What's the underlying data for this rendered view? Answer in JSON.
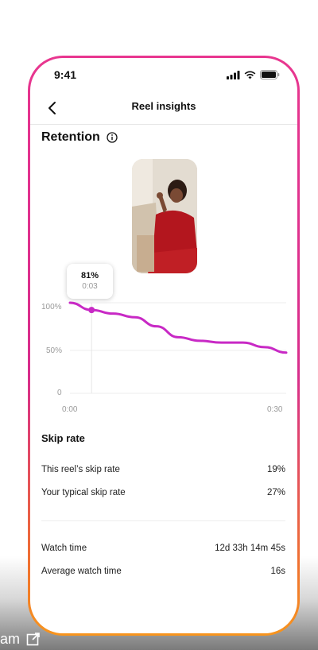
{
  "status_bar": {
    "time": "9:41"
  },
  "header": {
    "title": "Reel insights"
  },
  "retention": {
    "title": "Retention",
    "tooltip": {
      "value": "81%",
      "time": "0:03"
    },
    "chart_data": {
      "type": "line",
      "x": [
        0,
        3,
        6,
        9,
        12,
        15,
        18,
        21,
        24,
        27,
        30
      ],
      "values": [
        100,
        92,
        88,
        84,
        74,
        62,
        58,
        56,
        56,
        51,
        45
      ],
      "yticks": [
        "100%",
        "50%",
        "0"
      ],
      "xticks": [
        "0:00",
        "0:30"
      ],
      "ylim": [
        0,
        100
      ],
      "xlim": [
        0,
        30
      ],
      "highlight_x": 3,
      "line_color": "#c829c5"
    }
  },
  "skip_rate": {
    "title": "Skip rate",
    "rows": [
      {
        "label": "This reel’s skip rate",
        "value": "19%"
      },
      {
        "label": "Your typical skip rate",
        "value": "27%"
      }
    ]
  },
  "watch": {
    "rows": [
      {
        "label": "Watch time",
        "value": "12d 33h 14m 45s"
      },
      {
        "label": "Average watch time",
        "value": "16s"
      }
    ]
  },
  "footer": {
    "label": "am"
  }
}
